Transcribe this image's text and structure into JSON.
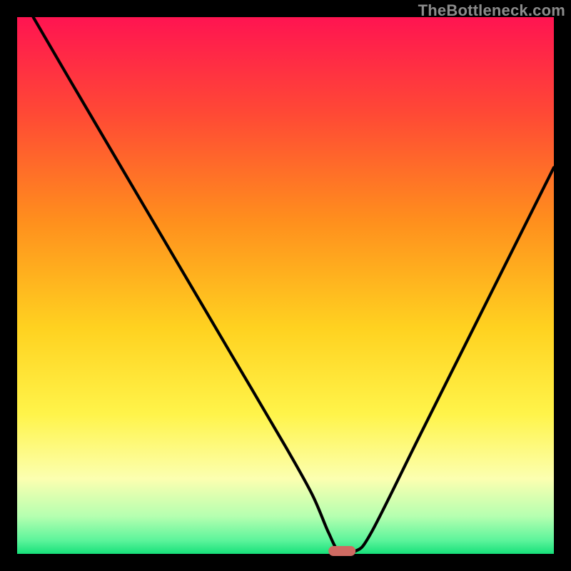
{
  "watermark": "TheBottleneck.com",
  "colors": {
    "frame": "#000000",
    "gradient_stops": [
      {
        "offset": 0.0,
        "color": "#ff1451"
      },
      {
        "offset": 0.18,
        "color": "#ff4935"
      },
      {
        "offset": 0.38,
        "color": "#ff8f1d"
      },
      {
        "offset": 0.58,
        "color": "#ffd220"
      },
      {
        "offset": 0.74,
        "color": "#fff44a"
      },
      {
        "offset": 0.86,
        "color": "#fcffb0"
      },
      {
        "offset": 0.93,
        "color": "#b5ffb0"
      },
      {
        "offset": 0.975,
        "color": "#5cf49b"
      },
      {
        "offset": 1.0,
        "color": "#17e07a"
      }
    ],
    "curve": "#000000",
    "marker": "#cf6a62"
  },
  "chart_data": {
    "type": "line",
    "title": "",
    "xlabel": "",
    "ylabel": "",
    "xlim": [
      0,
      100
    ],
    "ylim": [
      0,
      100
    ],
    "grid": false,
    "legend": false,
    "series": [
      {
        "name": "bottleneck-curve",
        "x": [
          3,
          10,
          20,
          30,
          40,
          50,
          55,
          58,
          60,
          63,
          66,
          75,
          85,
          95,
          100
        ],
        "y": [
          100,
          88,
          71,
          54,
          37,
          20,
          11,
          4,
          0.5,
          0.5,
          4,
          22,
          42,
          62,
          72
        ]
      }
    ],
    "marker": {
      "x_start": 58,
      "x_end": 63,
      "y": 0.5
    },
    "annotations": []
  }
}
